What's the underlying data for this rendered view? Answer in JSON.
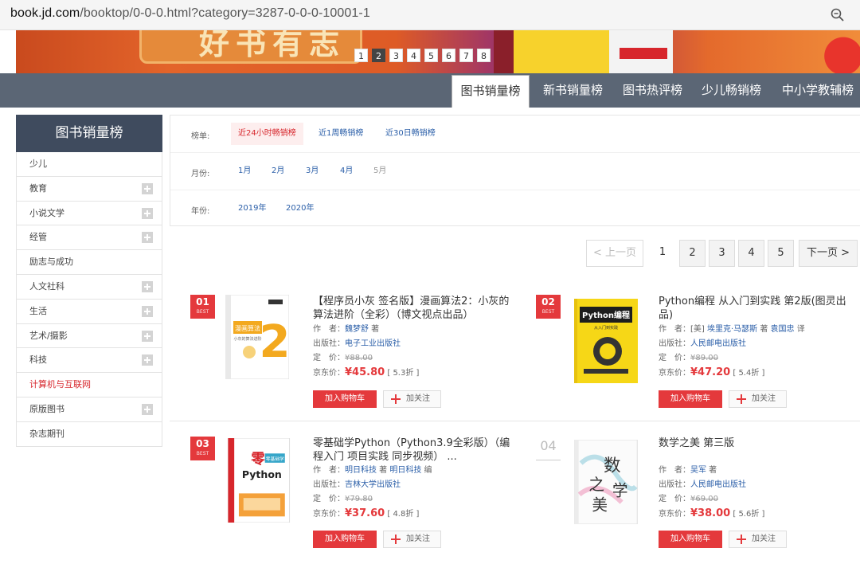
{
  "browser": {
    "url_host": "book.jd.com",
    "url_path": "/booktop/0-0-0.html?category=3287-0-0-0-10001-1"
  },
  "banner": {
    "title": "好书有志",
    "slides": [
      "1",
      "2",
      "3",
      "4",
      "5",
      "6",
      "7",
      "8"
    ],
    "active_slide": 2
  },
  "tabs": [
    "图书销量榜",
    "新书销量榜",
    "图书热评榜",
    "少儿畅销榜",
    "中小学教辅榜"
  ],
  "sidebar": {
    "title": "图书销量榜",
    "items": [
      {
        "label": "少儿",
        "expandable": false
      },
      {
        "label": "教育",
        "expandable": true
      },
      {
        "label": "小说文学",
        "expandable": true
      },
      {
        "label": "经管",
        "expandable": true
      },
      {
        "label": "励志与成功",
        "expandable": false
      },
      {
        "label": "人文社科",
        "expandable": true
      },
      {
        "label": "生活",
        "expandable": true
      },
      {
        "label": "艺术/摄影",
        "expandable": true
      },
      {
        "label": "科技",
        "expandable": true
      },
      {
        "label": "计算机与互联网",
        "expandable": false,
        "selected": true
      },
      {
        "label": "原版图书",
        "expandable": true
      },
      {
        "label": "杂志期刊",
        "expandable": false
      }
    ]
  },
  "filters": {
    "list": {
      "label": "榜单:",
      "options": [
        "近24小时畅销榜",
        "近1周畅销榜",
        "近30日畅销榜"
      ]
    },
    "month": {
      "label": "月份:",
      "options": [
        "1月",
        "2月",
        "3月",
        "4月",
        "5月"
      ]
    },
    "year": {
      "label": "年份:",
      "options": [
        "2019年",
        "2020年"
      ]
    }
  },
  "pager": {
    "prev": "< 上一页",
    "pages": [
      "1",
      "2",
      "3",
      "4",
      "5"
    ],
    "current": "1",
    "next": "下一页 >"
  },
  "labels": {
    "author": "作　者：",
    "publisher": "出版社：",
    "list_price": "定　价：",
    "jd_price": "京东价：",
    "add_cart": "加入购物车",
    "follow": "加关注",
    "best": "BEST"
  },
  "books": [
    {
      "rank": "01",
      "title": "【程序员小灰 签名版】漫画算法2：小灰的算法进阶（全彩）（博文视点出品）",
      "authors": [
        "魏梦舒"
      ],
      "author_suffix": " 著",
      "publisher": "电子工业出版社",
      "list_price": "¥88.00",
      "price": "¥45.80",
      "discount": "[ 5.3折 ]"
    },
    {
      "rank": "02",
      "title": "Python编程 从入门到实践 第2版(图灵出品)",
      "author_prefix": "[美] ",
      "authors": [
        "埃里克·马瑟斯"
      ],
      "author_mid": " 著 ",
      "translator": "袁国忠",
      "author_suffix": " 译",
      "publisher": "人民邮电出版社",
      "list_price": "¥89.00",
      "price": "¥47.20",
      "discount": "[ 5.4折 ]"
    },
    {
      "rank": "03",
      "title": "零基础学Python（Python3.9全彩版）（编程入门 项目实践 同步视频） ...",
      "authors": [
        "明日科技"
      ],
      "author_mid": " 著 ",
      "translator": "明日科技",
      "author_suffix": " 编",
      "publisher": "吉林大学出版社",
      "list_price": "¥79.80",
      "price": "¥37.60",
      "discount": "[ 4.8折 ]"
    },
    {
      "rank": "04",
      "title": "数学之美 第三版",
      "authors": [
        "吴军"
      ],
      "author_suffix": " 著",
      "publisher": "人民邮电出版社",
      "list_price": "¥69.00",
      "price": "¥38.00",
      "discount": "[ 5.6折 ]"
    }
  ],
  "cover_texts": {
    "b1": {
      "main": "漫画算法",
      "num": "2",
      "sub": "小灰的算法进阶"
    },
    "b2": {
      "main": "Python编程",
      "sub": "从入门到实践"
    },
    "b3": {
      "main": "零基础学",
      "lang": "Python"
    },
    "b4": {
      "main": "数学之美"
    }
  }
}
